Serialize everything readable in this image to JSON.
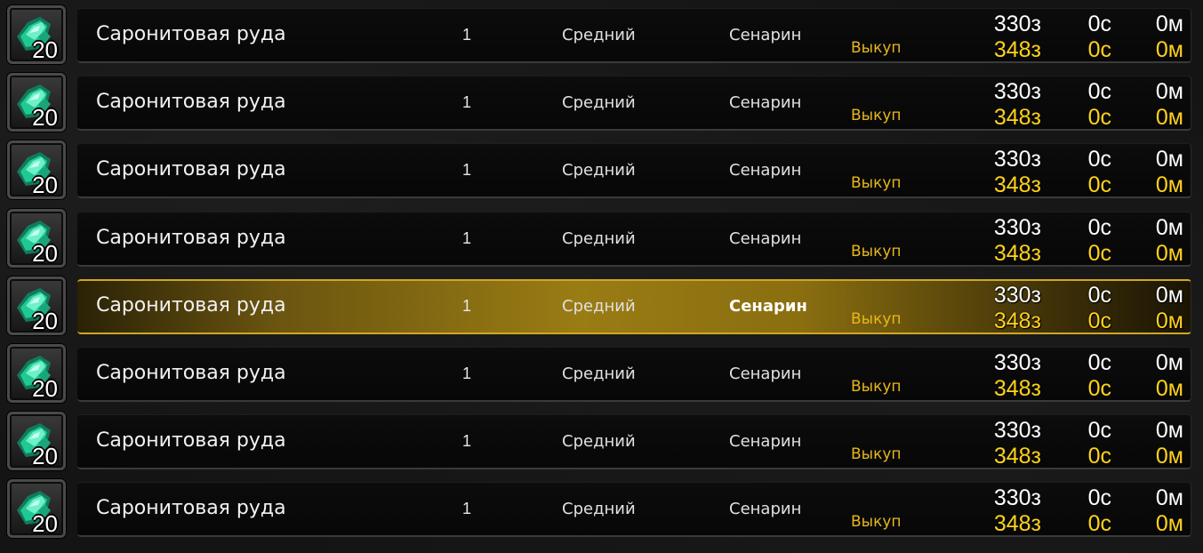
{
  "item": {
    "name": "Саронитовая руда",
    "stack_count": "20",
    "icon": "saronite-ore-icon"
  },
  "rows": [
    {
      "name": "Саронитовая руда",
      "stack": "20",
      "qty": "1",
      "time": "Средний",
      "seller": "Сенарин",
      "buyout_label": "Выкуп",
      "bid_g": "330з",
      "bid_s": "0с",
      "bid_c": "0м",
      "buy_g": "348з",
      "buy_s": "0с",
      "buy_c": "0м",
      "selected": false
    },
    {
      "name": "Саронитовая руда",
      "stack": "20",
      "qty": "1",
      "time": "Средний",
      "seller": "Сенарин",
      "buyout_label": "Выкуп",
      "bid_g": "330з",
      "bid_s": "0с",
      "bid_c": "0м",
      "buy_g": "348з",
      "buy_s": "0с",
      "buy_c": "0м",
      "selected": false
    },
    {
      "name": "Саронитовая руда",
      "stack": "20",
      "qty": "1",
      "time": "Средний",
      "seller": "Сенарин",
      "buyout_label": "Выкуп",
      "bid_g": "330з",
      "bid_s": "0с",
      "bid_c": "0м",
      "buy_g": "348з",
      "buy_s": "0с",
      "buy_c": "0м",
      "selected": false
    },
    {
      "name": "Саронитовая руда",
      "stack": "20",
      "qty": "1",
      "time": "Средний",
      "seller": "Сенарин",
      "buyout_label": "Выкуп",
      "bid_g": "330з",
      "bid_s": "0с",
      "bid_c": "0м",
      "buy_g": "348з",
      "buy_s": "0с",
      "buy_c": "0м",
      "selected": false
    },
    {
      "name": "Саронитовая руда",
      "stack": "20",
      "qty": "1",
      "time": "Средний",
      "seller": "Сенарин",
      "buyout_label": "Выкуп",
      "bid_g": "330з",
      "bid_s": "0с",
      "bid_c": "0м",
      "buy_g": "348з",
      "buy_s": "0с",
      "buy_c": "0м",
      "selected": true
    },
    {
      "name": "Саронитовая руда",
      "stack": "20",
      "qty": "1",
      "time": "Средний",
      "seller": "Сенарин",
      "buyout_label": "Выкуп",
      "bid_g": "330з",
      "bid_s": "0с",
      "bid_c": "0м",
      "buy_g": "348з",
      "buy_s": "0с",
      "buy_c": "0м",
      "selected": false
    },
    {
      "name": "Саронитовая руда",
      "stack": "20",
      "qty": "1",
      "time": "Средний",
      "seller": "Сенарин",
      "buyout_label": "Выкуп",
      "bid_g": "330з",
      "bid_s": "0с",
      "bid_c": "0м",
      "buy_g": "348з",
      "buy_s": "0с",
      "buy_c": "0м",
      "selected": false
    },
    {
      "name": "Саронитовая руда",
      "stack": "20",
      "qty": "1",
      "time": "Средний",
      "seller": "Сенарин",
      "buyout_label": "Выкуп",
      "bid_g": "330з",
      "bid_s": "0с",
      "bid_c": "0м",
      "buy_g": "348з",
      "buy_s": "0с",
      "buy_c": "0м",
      "selected": false
    }
  ],
  "colors": {
    "buyout_gold": "#ffd21a",
    "selection": "#9a7c14",
    "ore_green": "#2fd6a0"
  }
}
